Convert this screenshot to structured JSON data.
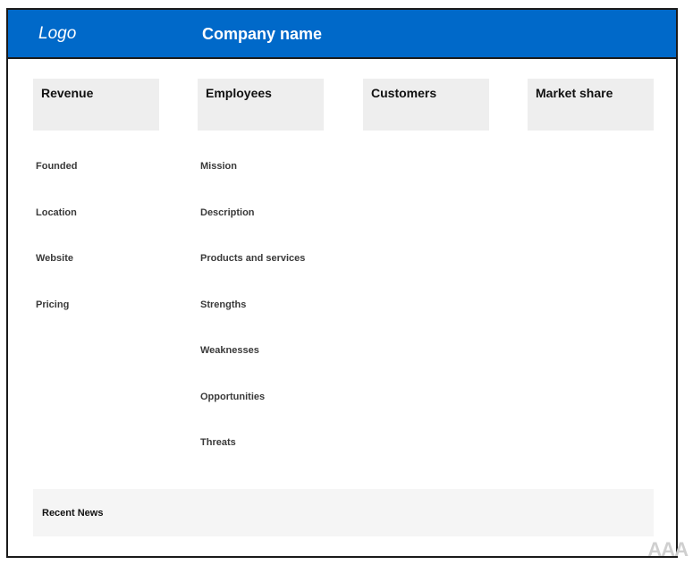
{
  "header": {
    "logo": "Logo",
    "company_name": "Company name"
  },
  "stats": [
    {
      "label": "Revenue"
    },
    {
      "label": "Employees"
    },
    {
      "label": "Customers"
    },
    {
      "label": "Market share"
    }
  ],
  "left_fields": [
    "Founded",
    "Location",
    "Website",
    "Pricing"
  ],
  "right_fields": [
    "Mission",
    "Description",
    "Products and services",
    "Strengths",
    "Weaknesses",
    "Opportunities",
    "Threats"
  ],
  "news": {
    "label": "Recent News"
  },
  "watermark": "AAA",
  "colors": {
    "header": "#0069c9",
    "card": "#eeeeee",
    "news": "#f5f5f5"
  }
}
